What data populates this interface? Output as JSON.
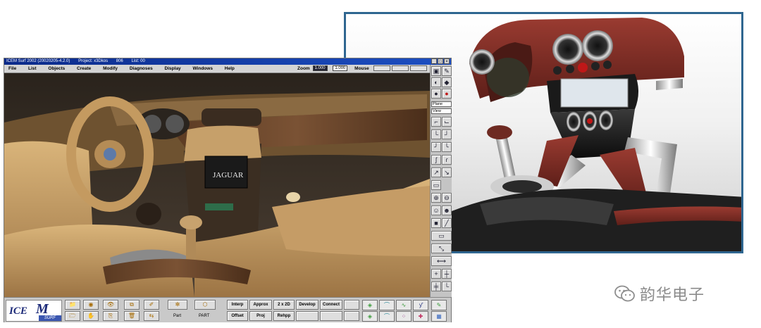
{
  "window": {
    "title": "ICEM Surf 2002 (20020205-4.2.0)",
    "project": "Project: x3Dkos",
    "field1": "806",
    "field2": "List: 00",
    "controls": [
      "_",
      "□",
      "×"
    ]
  },
  "menu": {
    "items": [
      "File",
      "List",
      "Objects",
      "Create",
      "Modify",
      "Diagnoses",
      "Display",
      "Windows",
      "Help"
    ],
    "zoom_label": "Zoom",
    "zoom_value": "1.000",
    "zoom_value2": "1.000",
    "mouse_label": "Mouse"
  },
  "viewport": {
    "screen_brand": "JAGUAR"
  },
  "palette": {
    "select1": "Plane",
    "select2": "View"
  },
  "bottom": {
    "logo_ice": "ICE",
    "logo_m": "M",
    "logo_surf": "SURF",
    "labels": [
      "Part",
      "PART"
    ],
    "buttons_row1": [
      "Interp",
      "Approx",
      "2 x 2D",
      "Develop",
      "Connect"
    ],
    "buttons_row2": [
      "Offset",
      "Proj",
      "Rehpp"
    ]
  },
  "watermark": {
    "text": "韵华电子"
  },
  "colors": {
    "title_blue": "#1d4fc2",
    "frame_blue": "#2f6690",
    "leather": "#c8a06a",
    "dash_red": "#7a2a22"
  },
  "icons": [
    "window-icon",
    "minimize-icon",
    "maximize-icon",
    "close-icon",
    "wechat-icon"
  ]
}
